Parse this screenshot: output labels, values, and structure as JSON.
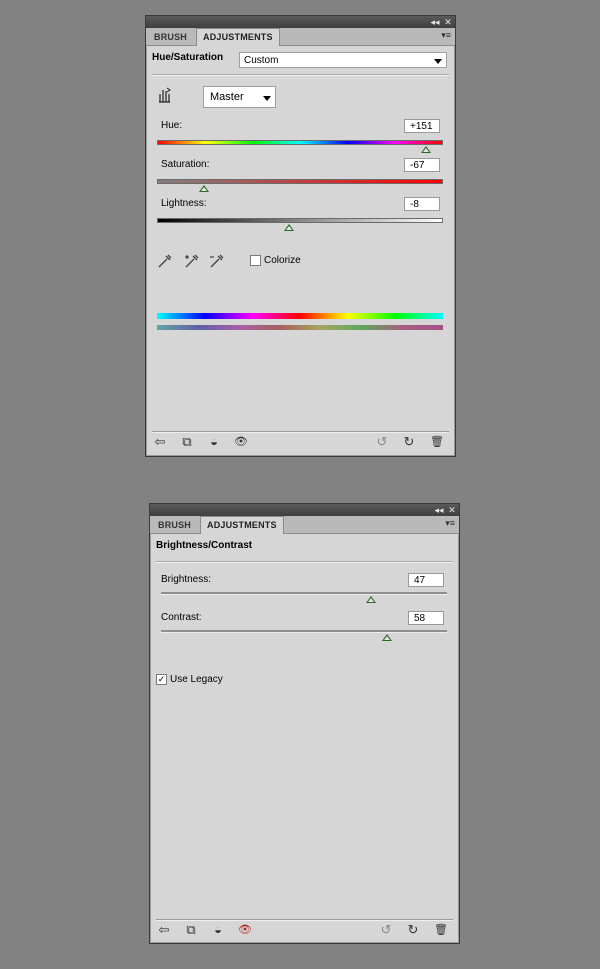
{
  "panel1": {
    "tabs": [
      "BRUSH",
      "ADJUSTMENTS"
    ],
    "active_tab": "ADJUSTMENTS",
    "title": "Hue/Saturation",
    "preset": "Custom",
    "channel": "Master",
    "hue": {
      "label": "Hue:",
      "value": "+151",
      "level": 0.94
    },
    "saturation": {
      "label": "Saturation:",
      "value": "-67",
      "level": 0.165
    },
    "lightness": {
      "label": "Lightness:",
      "value": "-8",
      "level": 0.46
    },
    "colorize_label": "Colorize",
    "colorize_checked": false
  },
  "panel2": {
    "tabs": [
      "BRUSH",
      "ADJUSTMENTS"
    ],
    "active_tab": "ADJUSTMENTS",
    "title": "Brightness/Contrast",
    "brightness": {
      "label": "Brightness:",
      "value": "47",
      "level": 0.735
    },
    "contrast": {
      "label": "Contrast:",
      "value": "58",
      "level": 0.79
    },
    "legacy_label": "Use Legacy",
    "legacy_checked": true,
    "check_mark": "✓"
  },
  "titlebar": {
    "collapse_glyph": "◂◂",
    "close_glyph": "✕",
    "menu_glyph": "▾≡"
  },
  "footer_icons": {
    "back": "⇦",
    "clip": "⧉",
    "view": "◒",
    "eye": "👁",
    "reset_prev": "↺",
    "reset": "↻",
    "trash": "🗑"
  },
  "colors": {
    "panel_bg": "#d6d6d6",
    "page_bg": "#828282",
    "thumb": "#2a6a2a"
  }
}
